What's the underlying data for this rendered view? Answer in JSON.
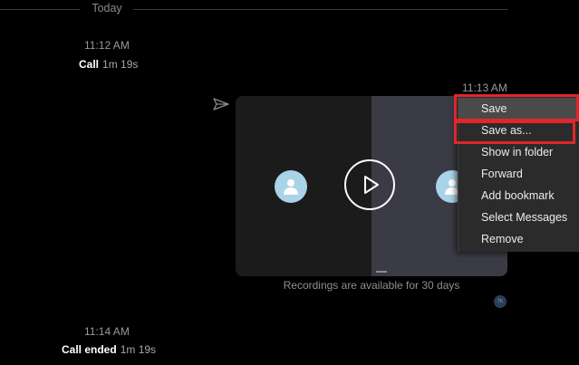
{
  "divider": {
    "label": "Today"
  },
  "messages": [
    {
      "time": "11:12 AM",
      "event": "Call",
      "duration": "1m 19s"
    },
    {
      "time": "11:14 AM",
      "event": "Call ended",
      "duration": "1m 19s"
    }
  ],
  "recording": {
    "time": "11:13 AM",
    "note": "Recordings are available for 30 days",
    "seen_initials": "TK"
  },
  "context_menu": {
    "items": [
      "Save",
      "Save as...",
      "Show in folder",
      "Forward",
      "Add bookmark",
      "Select Messages",
      "Remove"
    ],
    "highlighted": [
      "Save",
      "Save as..."
    ]
  },
  "colors": {
    "highlight_border": "#e0262b",
    "avatar": "#a9d3e8",
    "menu_bg": "#2b2b2b"
  }
}
